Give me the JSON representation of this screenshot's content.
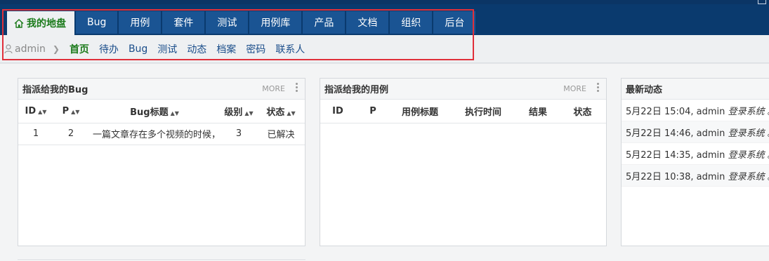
{
  "main_nav": {
    "tabs": [
      {
        "label": "我的地盘",
        "active": true
      },
      {
        "label": "Bug"
      },
      {
        "label": "用例"
      },
      {
        "label": "套件"
      },
      {
        "label": "测试"
      },
      {
        "label": "用例库"
      },
      {
        "label": "产品"
      },
      {
        "label": "文档"
      },
      {
        "label": "组织"
      },
      {
        "label": "后台"
      }
    ]
  },
  "sub_nav": {
    "user": "admin",
    "items": [
      "首页",
      "待办",
      "Bug",
      "测试",
      "动态",
      "档案",
      "密码",
      "联系人"
    ]
  },
  "bug_panel": {
    "title": "指派给我的Bug",
    "more": "MORE",
    "columns": [
      "ID",
      "P",
      "Bug标题",
      "级别",
      "状态"
    ],
    "rows": [
      {
        "id": "1",
        "p": "2",
        "title": "一篇文章存在多个视频的时候，",
        "severity": "3",
        "status": "已解决"
      }
    ]
  },
  "case_panel": {
    "title": "指派给我的用例",
    "more": "MORE",
    "columns": [
      "ID",
      "P",
      "用例标题",
      "执行时间",
      "结果",
      "状态"
    ]
  },
  "activity_panel": {
    "title": "最新动态",
    "entries": [
      {
        "time": "5月22日 15:04, admin",
        "action": "登录系统",
        "end": "。"
      },
      {
        "time": "5月22日 14:46, admin",
        "action": "登录系统",
        "end": "。"
      },
      {
        "time": "5月22日 14:35, admin",
        "action": "登录系统",
        "end": "。"
      },
      {
        "time": "5月22日 10:38, admin",
        "action": "登录系统",
        "end": "。"
      }
    ]
  },
  "colors": {
    "header": "#0a3a6e",
    "tab": "#1a5493",
    "active_green": "#1a7a1a",
    "highlight_red": "#e0303a"
  }
}
